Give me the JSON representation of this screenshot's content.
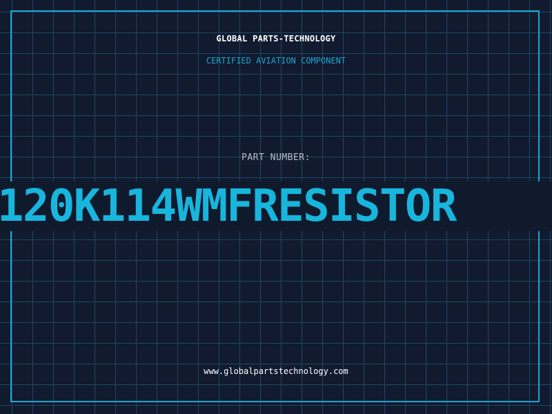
{
  "header": {
    "brand": "GLOBAL PARTS-TECHNOLOGY",
    "subtitle": "CERTIFIED AVIATION COMPONENT"
  },
  "part": {
    "label": "PART NUMBER:",
    "number": "120K114WMFRESISTOR"
  },
  "footer": {
    "url": "www.globalpartstechnology.com"
  },
  "colors": {
    "background": "#111a2f",
    "grid": "#1c4a63",
    "accent": "#1ba7d2",
    "part_number": "#18b5dd",
    "text": "#ffffff"
  }
}
